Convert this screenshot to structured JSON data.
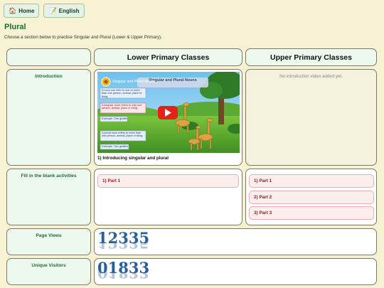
{
  "nav": {
    "home_label": "Home",
    "english_label": "English"
  },
  "page": {
    "title": "Plural",
    "subtitle": "Choose a section below to practise Singular and Plural (Lower & Upper Primary)."
  },
  "table": {
    "headers": [
      "Lower Primary Classes",
      "Upper Primary Classes"
    ],
    "rows": {
      "introduction": {
        "label": "Introduction",
        "lower_video": {
          "title": "Singular and Plural Nouns",
          "channel_title": "Singular and Plural Nouns",
          "caption": "1) Introducing singular and plural",
          "notes": [
            "A noun can refer to one or more than one person, animal, place or thing.",
            "A singular noun refers to only one person, animal, place or thing.",
            "Example: One giraffe",
            "A plural noun refers to more than one person, animal, place or thing.",
            "Example: Two giraffes"
          ]
        },
        "upper_message": "No introduction video added yet."
      },
      "fill_blank": {
        "label": "Fill in the blank activities",
        "lower_parts": [
          "1) Part 1"
        ],
        "upper_parts": [
          "1) Part 1",
          "2) Part 2",
          "3) Part 3"
        ]
      },
      "page_views": {
        "label": "Page Views",
        "digits": [
          "1",
          "2",
          "3",
          "3",
          "5"
        ]
      },
      "unique_visitors": {
        "label": "Unique Visitors",
        "digits": [
          "0",
          "1",
          "8",
          "3",
          "3"
        ]
      }
    }
  },
  "colors": {
    "accent_green": "#1e6b35",
    "part_red": "#9b1c24",
    "counter_blue": "#2a5f99"
  }
}
